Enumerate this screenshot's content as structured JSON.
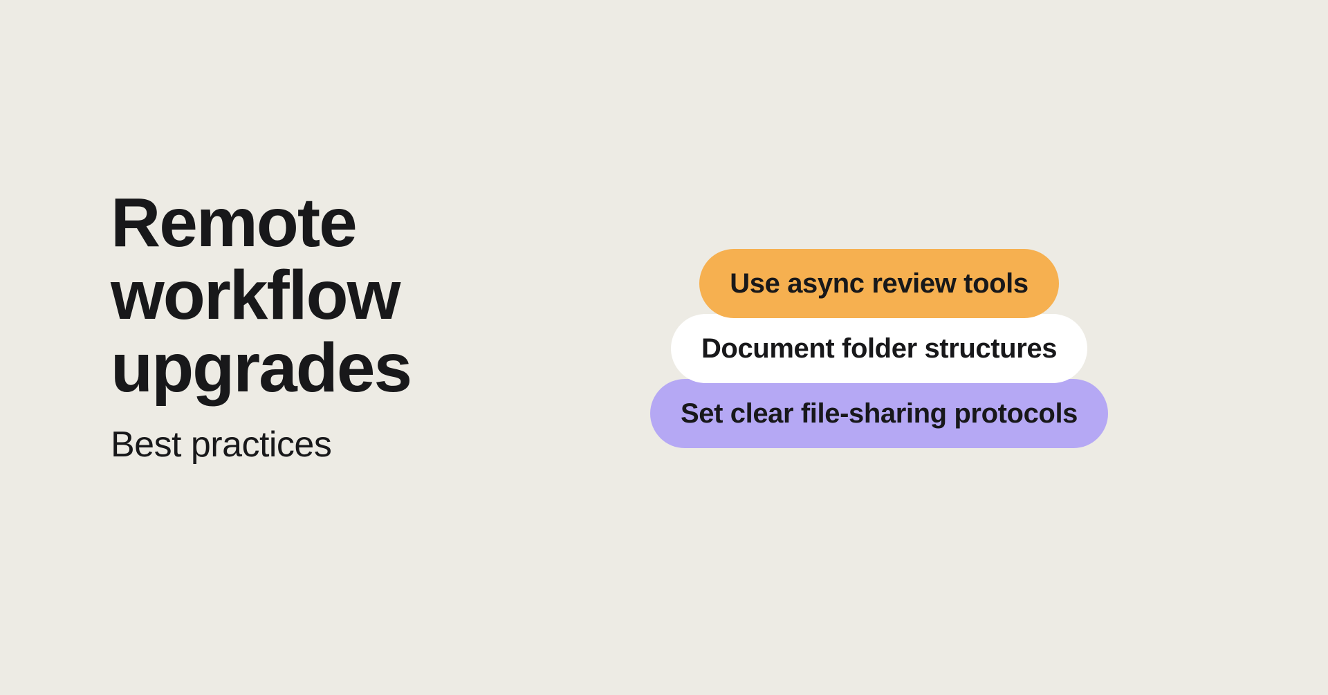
{
  "left": {
    "headline_line1": "Remote",
    "headline_line2": "workflow",
    "headline_line3": "upgrades",
    "subtitle": "Best practices"
  },
  "pills": [
    {
      "label": "Use async review tools",
      "color": "#f6b050"
    },
    {
      "label": "Document folder structures",
      "color": "#ffffff"
    },
    {
      "label": "Set clear file-sharing protocols",
      "color": "#b5a8f4"
    }
  ]
}
